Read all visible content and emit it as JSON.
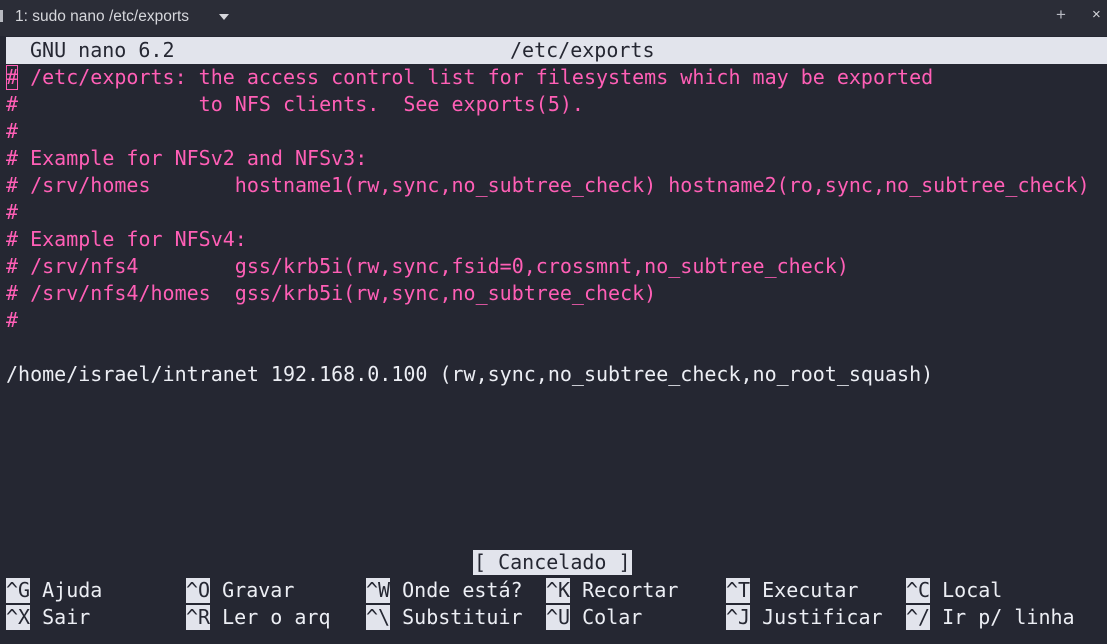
{
  "window": {
    "tab_title": "1: sudo nano /etc/exports",
    "add_tab_glyph": "+",
    "close_glyph": "×"
  },
  "nano": {
    "version": "GNU nano 6.2",
    "filename": "/etc/exports",
    "lines": [
      "# /etc/exports: the access control list for filesystems which may be exported",
      "#               to NFS clients.  See exports(5).",
      "#",
      "# Example for NFSv2 and NFSv3:",
      "# /srv/homes       hostname1(rw,sync,no_subtree_check) hostname2(ro,sync,no_subtree_check)",
      "#",
      "# Example for NFSv4:",
      "# /srv/nfs4        gss/krb5i(rw,sync,fsid=0,crossmnt,no_subtree_check)",
      "# /srv/nfs4/homes  gss/krb5i(rw,sync,no_subtree_check)",
      "#",
      "",
      "/home/israel/intranet 192.168.0.100 (rw,sync,no_subtree_check,no_root_squash)"
    ],
    "status_message": "[ Cancelado ]",
    "shortcuts_row1": [
      {
        "key": "^G",
        "label": "Ajuda"
      },
      {
        "key": "^O",
        "label": "Gravar"
      },
      {
        "key": "^W",
        "label": "Onde está?"
      },
      {
        "key": "^K",
        "label": "Recortar"
      },
      {
        "key": "^T",
        "label": "Executar"
      },
      {
        "key": "^C",
        "label": "Local"
      }
    ],
    "shortcuts_row2": [
      {
        "key": "^X",
        "label": "Sair"
      },
      {
        "key": "^R",
        "label": "Ler o arq"
      },
      {
        "key": "^\\",
        "label": "Substituir"
      },
      {
        "key": "^U",
        "label": "Colar"
      },
      {
        "key": "^J",
        "label": "Justificar"
      },
      {
        "key": "^/",
        "label": "Ir p/ linha"
      }
    ]
  },
  "colors": {
    "background": "#252732",
    "comment": "#ff5fb6",
    "text": "#eceef4",
    "bar": "#e2e4ec"
  }
}
